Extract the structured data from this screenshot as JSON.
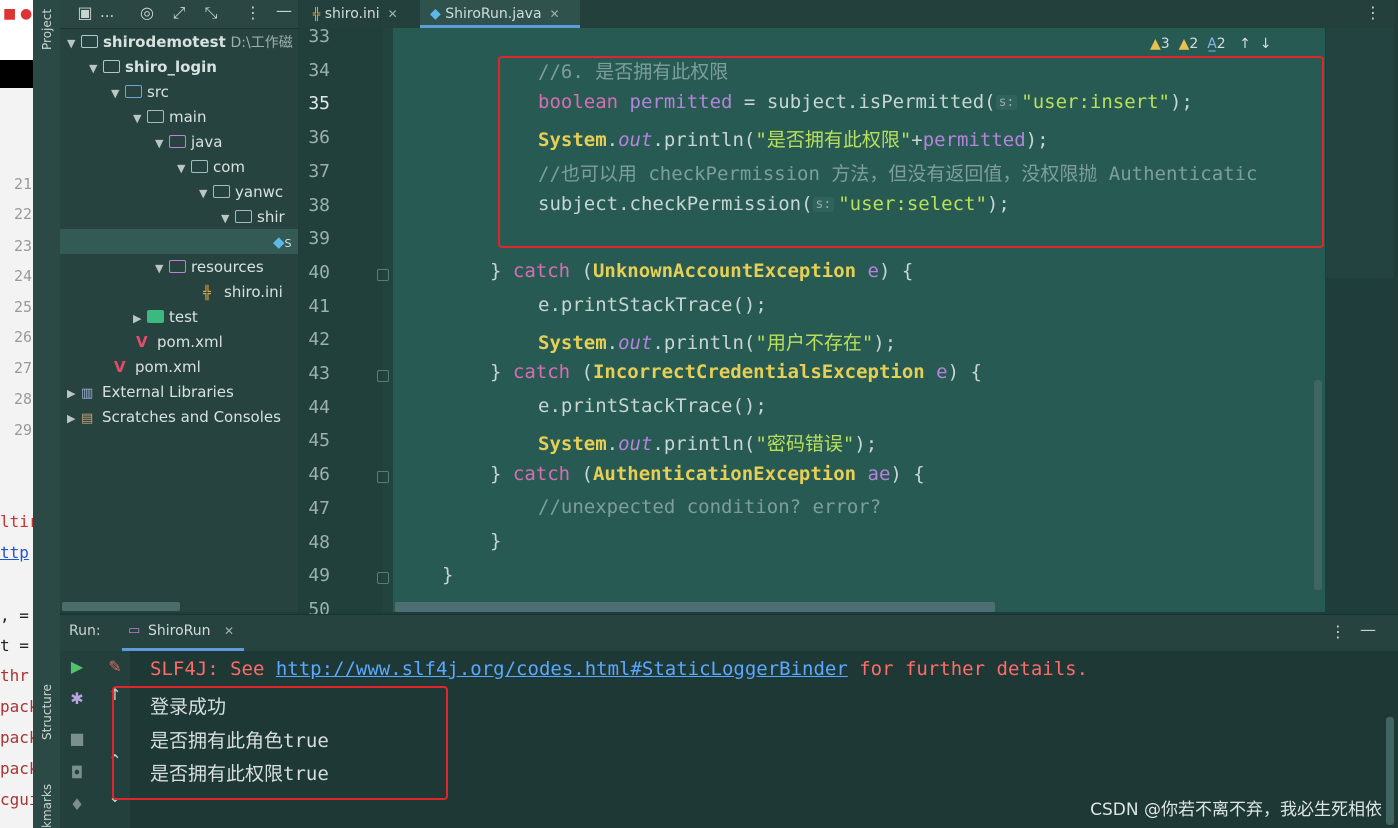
{
  "left_window": {
    "line_numbers": [
      "21",
      "22",
      "23",
      "24",
      "25",
      "26",
      "27",
      "28",
      "29"
    ],
    "text_fragments": [
      "ltir",
      "ttp",
      ", =",
      "t =",
      "thr",
      "pack",
      "pack",
      "pack",
      "cgui"
    ]
  },
  "side_tabs": {
    "project": "Project",
    "structure": "Structure",
    "bookmarks": "kmarks"
  },
  "project_panel": {
    "toolbar_label": "...",
    "tree": [
      {
        "label": "shirodemotest",
        "extra": "D:\\工作磁"
      },
      {
        "label": "shiro_login"
      },
      {
        "label": "src"
      },
      {
        "label": "main"
      },
      {
        "label": "java"
      },
      {
        "label": "com"
      },
      {
        "label": "yanwc"
      },
      {
        "label": "shir"
      },
      {
        "label": "S"
      },
      {
        "label": "resources"
      },
      {
        "label": "shiro.ini"
      },
      {
        "label": "test"
      },
      {
        "label": "pom.xml"
      },
      {
        "label": "pom.xml"
      },
      {
        "label": "External Libraries"
      },
      {
        "label": "Scratches and Consoles"
      }
    ]
  },
  "tabs": [
    {
      "label": "shiro.ini",
      "active": false
    },
    {
      "label": "ShiroRun.java",
      "active": true
    }
  ],
  "inspections": {
    "warnings": "3",
    "weak_warnings": "2",
    "typos": "2"
  },
  "editor": {
    "line_numbers": [
      "33",
      "34",
      "35",
      "36",
      "37",
      "38",
      "39",
      "40",
      "41",
      "42",
      "43",
      "44",
      "45",
      "46",
      "47",
      "48",
      "49",
      "50"
    ],
    "current_line": "35",
    "lines": {
      "l34": "//6. 是否拥有此权限",
      "l35_kw": "boolean",
      "l35_var": "permitted",
      "l35_eq": " = ",
      "l35_call": "subject.isPermitted(",
      "l35_hint": "s:",
      "l35_str": "\"user:insert\"",
      "l35_end": ");",
      "l36_cls": "System",
      "l36_dot": ".",
      "l36_out": "out",
      "l36_call": ".println(",
      "l36_str": "\"是否拥有此权限\"",
      "l36_plus": "+",
      "l36_var": "permitted",
      "l36_end": ");",
      "l37": "//也可以用 checkPermission 方法，但没有返回值，没权限抛 Authenticatic",
      "l38_call": "subject.checkPermission(",
      "l38_hint": "s:",
      "l38_str": "\"user:select\"",
      "l38_end": ");",
      "l40_pre": "} ",
      "l40_kw": "catch",
      "l40_open": " (",
      "l40_cls": "UnknownAccountException",
      "l40_var": " e",
      "l40_end": ") {",
      "l41": "e.printStackTrace();",
      "l42_cls": "System",
      "l42_dot": ".",
      "l42_out": "out",
      "l42_call": ".println(",
      "l42_str": "\"用户不存在\"",
      "l42_end": ");",
      "l43_pre": "} ",
      "l43_kw": "catch",
      "l43_open": " (",
      "l43_cls": "IncorrectCredentialsException",
      "l43_var": " e",
      "l43_end": ") {",
      "l44": "e.printStackTrace();",
      "l45_cls": "System",
      "l45_dot": ".",
      "l45_out": "out",
      "l45_call": ".println(",
      "l45_str": "\"密码错误\"",
      "l45_end": ");",
      "l46_pre": "} ",
      "l46_kw": "catch",
      "l46_open": " (",
      "l46_cls": "AuthenticationException",
      "l46_var": " ae",
      "l46_end": ") {",
      "l47": "//unexpected condition? error?",
      "l48": "}",
      "l49": "}"
    }
  },
  "run_panel": {
    "label": "Run:",
    "tab": "ShiroRun",
    "console": {
      "slf_prefix": "SLF4J: See ",
      "slf_link": "http://www.slf4j.org/codes.html#StaticLoggerBinder",
      "slf_suffix": " for further details.",
      "out1": "登录成功",
      "out2": "是否拥有此角色true",
      "out3": "是否拥有此权限true"
    }
  },
  "watermark": "CSDN @你若不离不弃，我必生死相依",
  "colors": {
    "highlight_box": "#e0262a",
    "editor_bg": "#285a54"
  }
}
